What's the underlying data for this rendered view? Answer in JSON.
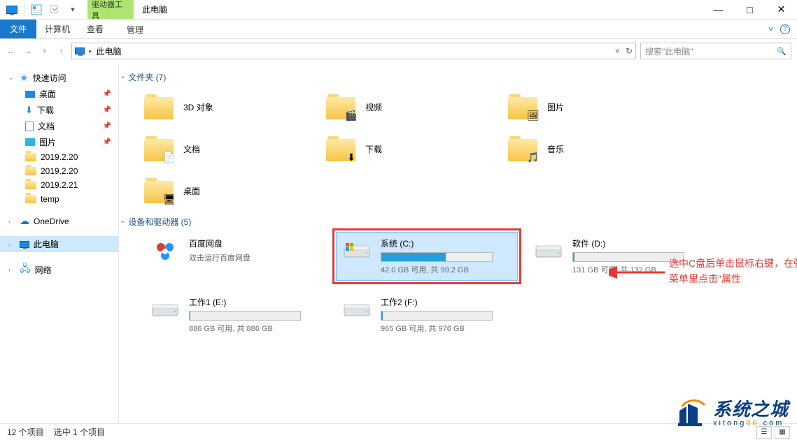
{
  "window": {
    "drive_tools": "驱动器工具",
    "title": "此电脑",
    "controls": {
      "min": "—",
      "max": "□",
      "close": "✕"
    }
  },
  "ribbon": {
    "file": "文件",
    "tabs": [
      "计算机",
      "查看"
    ],
    "manage": "管理",
    "expand": "˅",
    "help": "?"
  },
  "nav": {
    "back": "←",
    "fwd": "→",
    "recent": "˅",
    "up": "↑",
    "crumb_root": "此电脑",
    "refresh": "↻",
    "addr_drop": "˅"
  },
  "search": {
    "placeholder": "搜索\"此电脑\"",
    "icon": "🔍"
  },
  "sidebar": {
    "quick": "快速访问",
    "items": [
      {
        "label": "桌面",
        "pinned": true,
        "kind": "desktop"
      },
      {
        "label": "下载",
        "pinned": true,
        "kind": "download"
      },
      {
        "label": "文档",
        "pinned": true,
        "kind": "doc"
      },
      {
        "label": "图片",
        "pinned": true,
        "kind": "pic"
      },
      {
        "label": "2019.2.20",
        "pinned": false,
        "kind": "folder"
      },
      {
        "label": "2019.2.20",
        "pinned": false,
        "kind": "folder"
      },
      {
        "label": "2019.2.21",
        "pinned": false,
        "kind": "folder"
      },
      {
        "label": "temp",
        "pinned": false,
        "kind": "folder"
      }
    ],
    "onedrive": "OneDrive",
    "thispc": "此电脑",
    "network": "网络"
  },
  "sections": {
    "folders": {
      "title": "文件夹 (7)"
    },
    "drives": {
      "title": "设备和驱动器 (5)"
    }
  },
  "folders": [
    {
      "label": "3D 对象",
      "overlay": ""
    },
    {
      "label": "视频",
      "overlay": "🎬"
    },
    {
      "label": "图片",
      "overlay": "🖼"
    },
    {
      "label": "文档",
      "overlay": "📄"
    },
    {
      "label": "下载",
      "overlay": "⬇"
    },
    {
      "label": "音乐",
      "overlay": "🎵"
    },
    {
      "label": "桌面",
      "overlay": "🖥"
    }
  ],
  "drives": [
    {
      "name": "百度网盘",
      "sub": "双击运行百度网盘",
      "type": "baidu"
    },
    {
      "name": "系统 (C:)",
      "meta": "42.0 GB 可用, 共 99.2 GB",
      "fill": 58,
      "type": "os",
      "selected": true,
      "highlighted": true
    },
    {
      "name": "软件 (D:)",
      "meta": "131 GB 可用, 共 132 GB",
      "fill": 1,
      "type": "hdd"
    },
    {
      "name": "工作1 (E:)",
      "meta": "886 GB 可用, 共 886 GB",
      "fill": 0.3,
      "type": "hdd"
    },
    {
      "name": "工作2 (F:)",
      "meta": "965 GB 可用, 共 976 GB",
      "fill": 1.2,
      "type": "hdd"
    }
  ],
  "annotation": {
    "line1": "选中C盘后单击鼠标右键，在弹出的",
    "line2": "菜单里点击\"属性"
  },
  "status": {
    "count": "12 个项目",
    "selected": "选中 1 个项目"
  },
  "watermark": {
    "main": "系统之城",
    "sub_pre": "xitong",
    "sub_mid": "86",
    "sub_post": ".com"
  }
}
